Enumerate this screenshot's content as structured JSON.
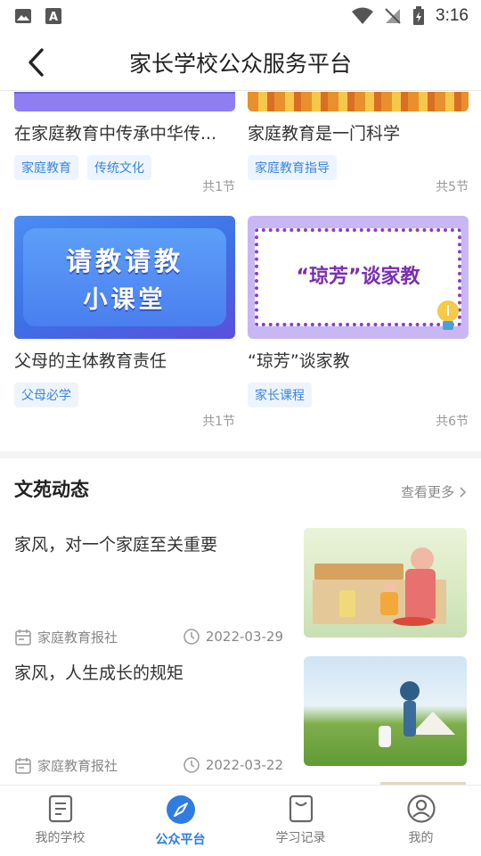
{
  "status_bar": {
    "time": "3:16"
  },
  "app_bar": {
    "title": "家长学校公众服务平台"
  },
  "courses": [
    {
      "title": "在家庭教育中传承中华传...",
      "tags": [
        "家庭教育",
        "传统文化"
      ],
      "count": "共1节"
    },
    {
      "title": "家庭教育是一门科学",
      "tags": [
        "家庭教育指导"
      ],
      "count": "共5节"
    },
    {
      "title": "父母的主体教育责任",
      "tags": [
        "父母必学"
      ],
      "count": "共1节",
      "thumb_text": [
        "请教请教",
        "小课堂"
      ]
    },
    {
      "title": "“琼芳”谈家教",
      "tags": [
        "家长课程"
      ],
      "count": "共6节",
      "thumb_text": "“琼芳”谈家教"
    }
  ],
  "news_section": {
    "title": "文苑动态",
    "more": "查看更多"
  },
  "news": [
    {
      "title": "家风，对一个家庭至关重要",
      "source": "家庭教育报社",
      "date": "2022-03-29"
    },
    {
      "title": "家风，人生成长的规矩",
      "source": "家庭教育报社",
      "date": "2022-03-22"
    }
  ],
  "tabs": [
    {
      "label": "我的学校",
      "icon": "school-icon",
      "active": false
    },
    {
      "label": "公众平台",
      "icon": "compass-icon",
      "active": true
    },
    {
      "label": "学习记录",
      "icon": "record-icon",
      "active": false
    },
    {
      "label": "我的",
      "icon": "user-icon",
      "active": false
    }
  ],
  "colors": {
    "accent": "#2f7de1",
    "tag_bg": "#eef4fd",
    "tag_text": "#3a86e0"
  }
}
